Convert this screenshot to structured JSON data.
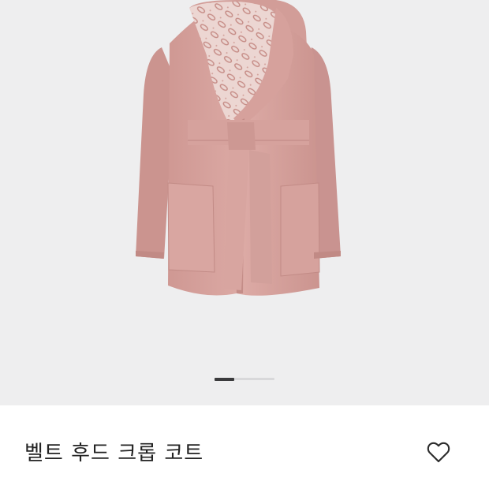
{
  "product": {
    "name": "벨트 후드 크롭 코트",
    "color": "#d9a6a1",
    "image_icon": "belted-hooded-coat-image"
  },
  "gallery": {
    "background": "#eeeeef",
    "pager_total": 3,
    "pager_current": 1
  },
  "actions": {
    "wishlist_icon": "heart-outline-icon"
  }
}
